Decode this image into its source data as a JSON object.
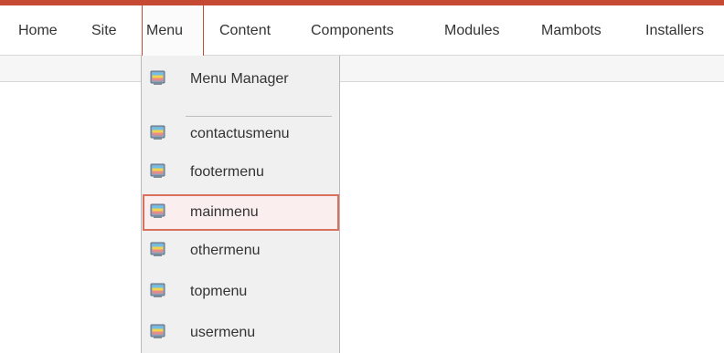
{
  "menubar": {
    "items": [
      {
        "label": "Home"
      },
      {
        "label": "Site"
      },
      {
        "label": "Menu"
      },
      {
        "label": "Content"
      },
      {
        "label": "Components"
      },
      {
        "label": "Modules"
      },
      {
        "label": "Mambots"
      },
      {
        "label": "Installers"
      }
    ],
    "active_item": "Menu",
    "accent_color": "#c64934"
  },
  "dropdown": {
    "top_item": {
      "label": "Menu Manager",
      "icon": "menu-icon"
    },
    "menus": [
      {
        "label": "contactusmenu",
        "icon": "menu-icon"
      },
      {
        "label": "footermenu",
        "icon": "menu-icon"
      },
      {
        "label": "mainmenu",
        "icon": "menu-icon",
        "highlighted": true
      },
      {
        "label": "othermenu",
        "icon": "menu-icon"
      },
      {
        "label": "topmenu",
        "icon": "menu-icon"
      },
      {
        "label": "usermenu",
        "icon": "menu-icon"
      }
    ],
    "highlight_color": "#d8705e"
  }
}
